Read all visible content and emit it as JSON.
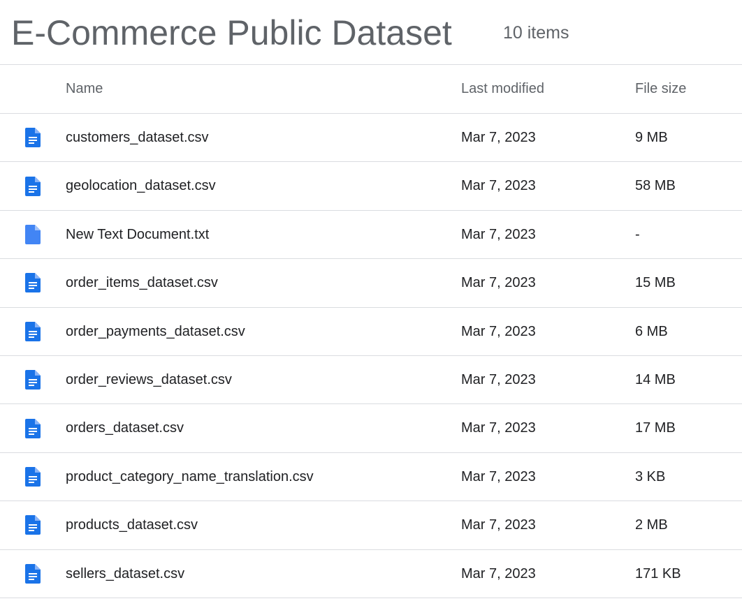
{
  "header": {
    "title": "E-Commerce Public Dataset",
    "item_count": "10 items"
  },
  "columns": {
    "name": "Name",
    "last_modified": "Last modified",
    "file_size": "File size"
  },
  "colors": {
    "icon_blue": "#1a73e8",
    "icon_blue_light": "#4285f4",
    "divider": "#dadce0",
    "muted_text": "#5f6368"
  },
  "files": [
    {
      "name": "customers_dataset.csv",
      "modified": "Mar 7, 2023",
      "size": "9 MB",
      "icon": "document-lines-icon"
    },
    {
      "name": "geolocation_dataset.csv",
      "modified": "Mar 7, 2023",
      "size": "58 MB",
      "icon": "document-lines-icon"
    },
    {
      "name": "New Text Document.txt",
      "modified": "Mar 7, 2023",
      "size": "-",
      "icon": "blank-document-icon"
    },
    {
      "name": "order_items_dataset.csv",
      "modified": "Mar 7, 2023",
      "size": "15 MB",
      "icon": "document-lines-icon"
    },
    {
      "name": "order_payments_dataset.csv",
      "modified": "Mar 7, 2023",
      "size": "6 MB",
      "icon": "document-lines-icon"
    },
    {
      "name": "order_reviews_dataset.csv",
      "modified": "Mar 7, 2023",
      "size": "14 MB",
      "icon": "document-lines-icon"
    },
    {
      "name": "orders_dataset.csv",
      "modified": "Mar 7, 2023",
      "size": "17 MB",
      "icon": "document-lines-icon"
    },
    {
      "name": "product_category_name_translation.csv",
      "modified": "Mar 7, 2023",
      "size": "3 KB",
      "icon": "document-lines-icon"
    },
    {
      "name": "products_dataset.csv",
      "modified": "Mar 7, 2023",
      "size": "2 MB",
      "icon": "document-lines-icon"
    },
    {
      "name": "sellers_dataset.csv",
      "modified": "Mar 7, 2023",
      "size": "171 KB",
      "icon": "document-lines-icon"
    }
  ]
}
